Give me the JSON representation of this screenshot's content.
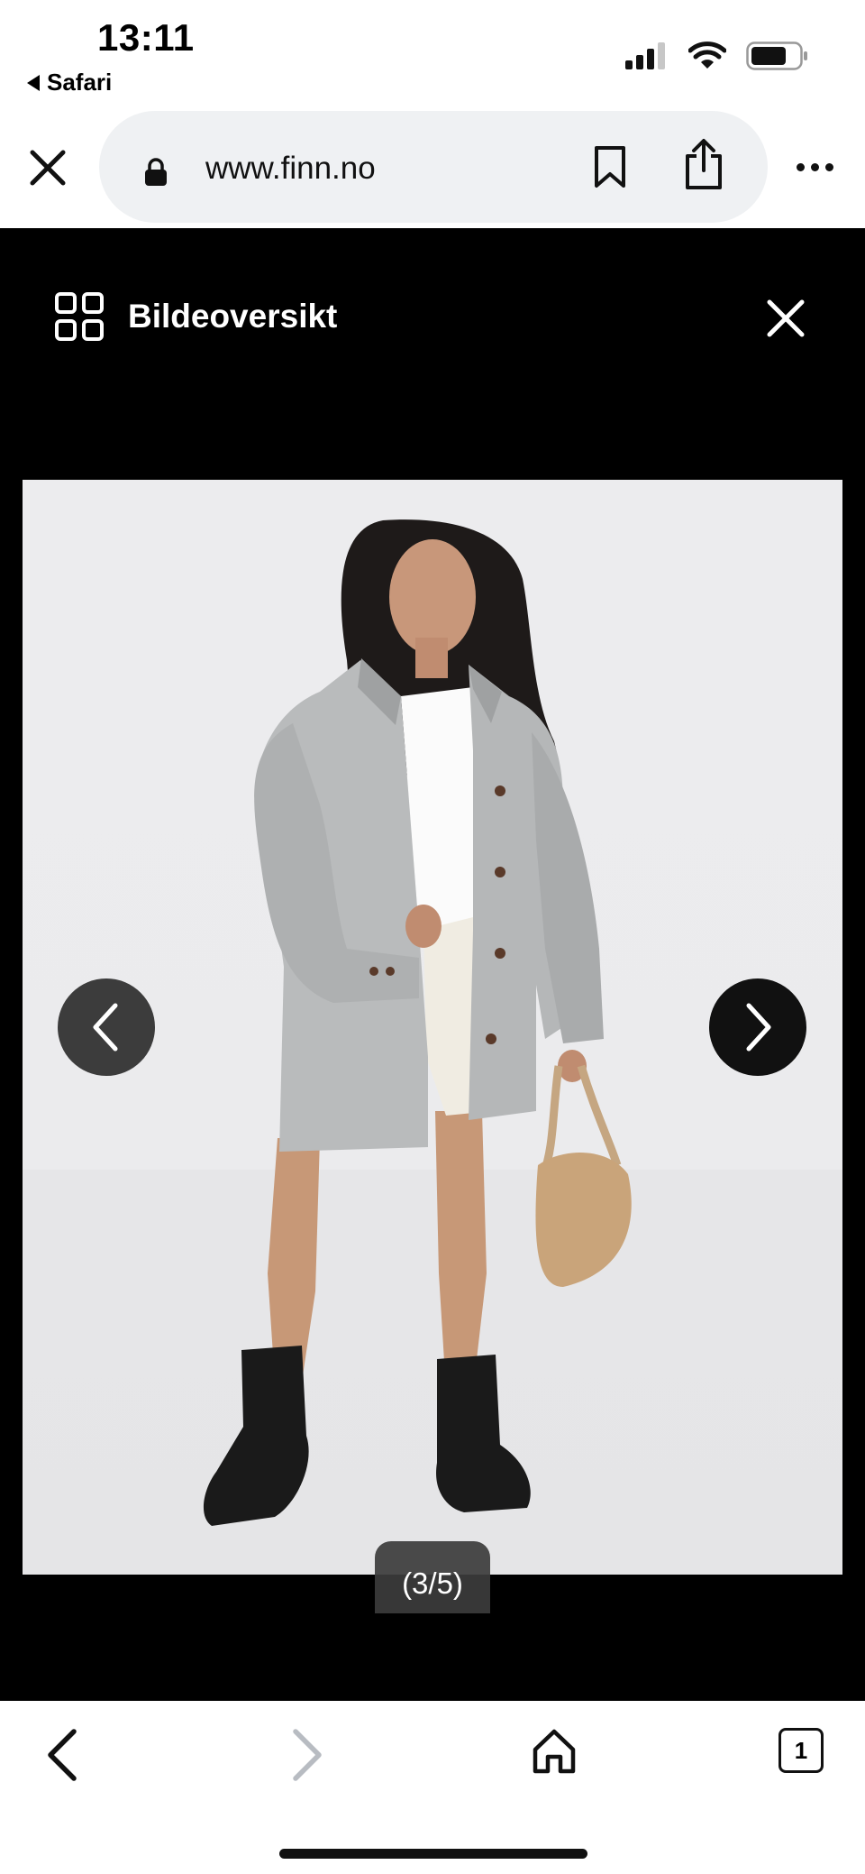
{
  "status_bar": {
    "time": "13:11",
    "back_app": "Safari",
    "icons": [
      "signal-icon",
      "wifi-icon",
      "battery-icon"
    ]
  },
  "browser": {
    "url": "www.finn.no",
    "icons": [
      "close-icon",
      "lock-icon",
      "bookmark-icon",
      "share-icon",
      "more-icon"
    ]
  },
  "gallery": {
    "overview_label": "Bildeoversikt",
    "counter": "(3/5)",
    "current_image": 3,
    "total_images": 5,
    "image_subject": ""
  },
  "toolbar": {
    "tabs_count": "1",
    "icons": [
      "back-arrow-icon",
      "forward-arrow-icon",
      "home-icon",
      "tabs-icon"
    ]
  },
  "colors": {
    "gallery_background": "#000000",
    "url_pill": "#eff1f3",
    "nav_prev": "#3c3c3c",
    "nav_next": "#111111"
  }
}
